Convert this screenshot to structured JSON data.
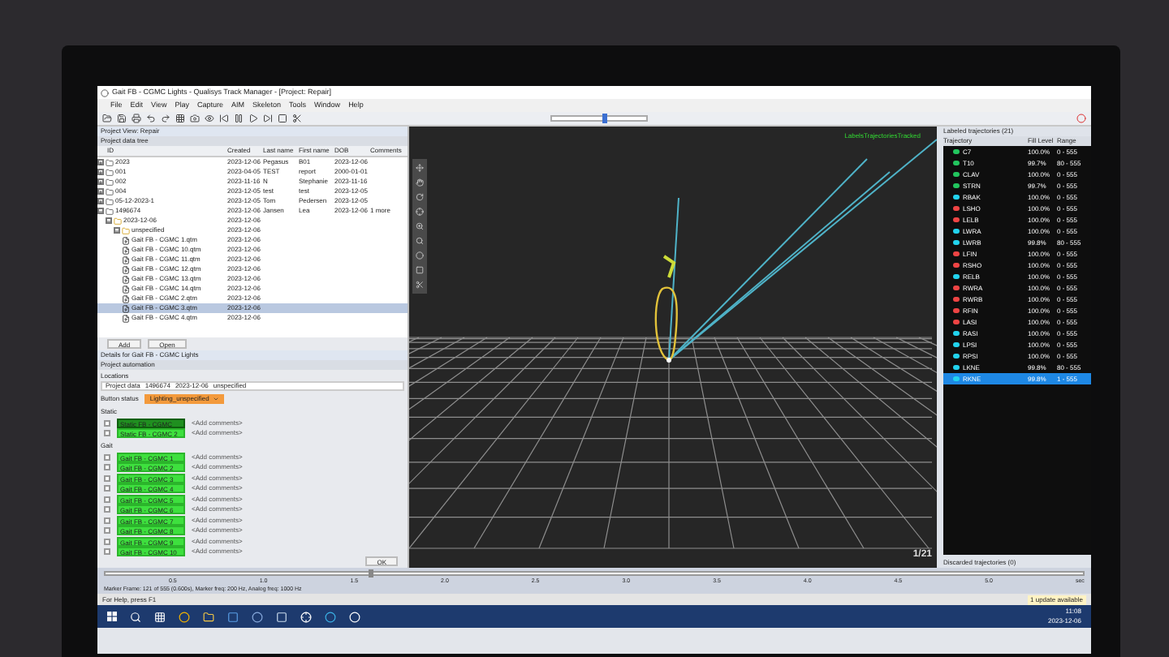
{
  "window": {
    "title": "Gait FB - CGMC Lights - Qualisys Track Manager - [Project: Repair]"
  },
  "speed_slider": {
    "level": 0.55
  },
  "menu": [
    "File",
    "Edit",
    "View",
    "Play",
    "Capture",
    "AIM",
    "Skeleton",
    "Tools",
    "Window",
    "Help"
  ],
  "project_view": {
    "title": "Project View: Repair",
    "tree_title": "Project data tree",
    "columns": [
      "ID",
      "Created",
      "Last name",
      "First name",
      "DOB",
      "Comments"
    ],
    "rows": [
      {
        "kind": "folder",
        "cells": [
          "2023",
          "2023-12-06",
          "Pegasus",
          "B01",
          "2023-12-06"
        ],
        "expanded": false,
        "selected": false
      },
      {
        "kind": "folder",
        "cells": [
          "001",
          "2023-04-05",
          "TEST",
          "report",
          "2000-01-01"
        ],
        "expanded": false,
        "selected": false
      },
      {
        "kind": "folder",
        "cells": [
          "002",
          "2023-11-16",
          "N",
          "Stephanie",
          "2023-11-16"
        ],
        "expanded": false,
        "selected": false
      },
      {
        "kind": "folder",
        "cells": [
          "004",
          "2023-12-05",
          "test",
          "test",
          "2023-12-05"
        ],
        "expanded": false,
        "selected": false
      },
      {
        "kind": "folder",
        "cells": [
          "05-12-2023-1",
          "2023-12-05",
          "Tom",
          "Pedersen",
          "2023-12-05"
        ],
        "expanded": false,
        "selected": false
      },
      {
        "kind": "folder",
        "cells": [
          "1496674",
          "2023-12-06",
          "Jansen",
          "Lea",
          "2023-12-06",
          "1 more"
        ],
        "expanded": true,
        "selected": false,
        "children": [
          {
            "kind": "folder",
            "cells": [
              "2023-12-06",
              "2023-12-06"
            ],
            "expanded": true,
            "selected": false,
            "children": [
              {
                "kind": "folder",
                "cells": [
                  "unspecified",
                  "2023-12-06"
                ],
                "expanded": true,
                "selected": false,
                "children": [
                  {
                    "kind": "file",
                    "cells": [
                      "Gait FB - CGMC 1.qtm",
                      "2023-12-06"
                    ],
                    "selected": false
                  },
                  {
                    "kind": "file",
                    "cells": [
                      "Gait FB - CGMC 10.qtm",
                      "2023-12-06"
                    ],
                    "selected": false
                  },
                  {
                    "kind": "file",
                    "cells": [
                      "Gait FB - CGMC 11.qtm",
                      "2023-12-06"
                    ],
                    "selected": false
                  },
                  {
                    "kind": "file",
                    "cells": [
                      "Gait FB - CGMC 12.qtm",
                      "2023-12-06"
                    ],
                    "selected": false
                  },
                  {
                    "kind": "file",
                    "cells": [
                      "Gait FB - CGMC 13.qtm",
                      "2023-12-06"
                    ],
                    "selected": false
                  },
                  {
                    "kind": "file",
                    "cells": [
                      "Gait FB - CGMC 14.qtm",
                      "2023-12-06"
                    ],
                    "selected": false
                  },
                  {
                    "kind": "file",
                    "cells": [
                      "Gait FB - CGMC 2.qtm",
                      "2023-12-06"
                    ],
                    "selected": false
                  },
                  {
                    "kind": "file",
                    "cells": [
                      "Gait FB - CGMC 3.qtm",
                      "2023-12-06"
                    ],
                    "selected": true
                  },
                  {
                    "kind": "file",
                    "cells": [
                      "Gait FB - CGMC 4.qtm",
                      "2023-12-06"
                    ],
                    "selected": false
                  }
                ]
              }
            ]
          }
        ]
      }
    ],
    "buttons": [
      "Add",
      "Open"
    ]
  },
  "details": {
    "title": "Details for Gait FB - CGMC Lights",
    "automation_title": "Project automation",
    "locations_label": "Locations",
    "path": [
      "Project data",
      "1496674",
      "2023-12-06",
      "unspecified"
    ],
    "status_label": "Button status",
    "status_value": "Lighting_unspecified",
    "groups": [
      {
        "label": "Static",
        "items": [
          {
            "name": "Static FB - CGMC",
            "selected": true,
            "checked": false,
            "comment": "<Add comments>"
          },
          {
            "name": "Static FB - CGMC 2",
            "selected": false,
            "checked": false,
            "comment": "<Add comments>"
          }
        ]
      },
      {
        "label": "Gait",
        "items": [
          {
            "name": "Gait FB - CGMC 1",
            "selected": false,
            "checked": false,
            "comment": "<Add comments>"
          },
          {
            "name": "Gait FB - CGMC 2",
            "selected": false,
            "checked": false,
            "comment": "<Add comments>"
          },
          {
            "name": "Gait FB - CGMC 3",
            "selected": false,
            "checked": false,
            "comment": "<Add comments>"
          },
          {
            "name": "Gait FB - CGMC 4",
            "selected": false,
            "checked": false,
            "comment": "<Add comments>"
          },
          {
            "name": "Gait FB - CGMC 5",
            "selected": false,
            "checked": false,
            "comment": "<Add comments>"
          },
          {
            "name": "Gait FB - CGMC 6",
            "selected": false,
            "checked": false,
            "comment": "<Add comments>"
          },
          {
            "name": "Gait FB - CGMC 7",
            "selected": false,
            "checked": false,
            "comment": "<Add comments>"
          },
          {
            "name": "Gait FB - CGMC 8",
            "selected": false,
            "checked": false,
            "comment": "<Add comments>"
          },
          {
            "name": "Gait FB - CGMC 9",
            "selected": false,
            "checked": false,
            "comment": "<Add comments>"
          },
          {
            "name": "Gait FB - CGMC 10",
            "selected": false,
            "checked": false,
            "comment": "<Add comments>"
          }
        ]
      }
    ],
    "ok_button": "OK"
  },
  "viewer": {
    "overlay_label": "LabelsTrajectoriesTracked",
    "frame": "1/21"
  },
  "trajectories": {
    "title": "Labeled trajectories (21)",
    "columns": [
      "Trajectory",
      "Fill Level",
      "Range"
    ],
    "rows": [
      {
        "name": "C7",
        "color": "#22c55e",
        "fill": "100.0%",
        "range": "0 - 555",
        "selected": false
      },
      {
        "name": "T10",
        "color": "#22c55e",
        "fill": "99.7%",
        "range": "80 - 555",
        "selected": false
      },
      {
        "name": "CLAV",
        "color": "#22c55e",
        "fill": "100.0%",
        "range": "0 - 555",
        "selected": false
      },
      {
        "name": "STRN",
        "color": "#22c55e",
        "fill": "99.7%",
        "range": "0 - 555",
        "selected": false
      },
      {
        "name": "RBAK",
        "color": "#22d3ee",
        "fill": "100.0%",
        "range": "0 - 555",
        "selected": false
      },
      {
        "name": "LSHO",
        "color": "#ef4444",
        "fill": "100.0%",
        "range": "0 - 555",
        "selected": false
      },
      {
        "name": "LELB",
        "color": "#ef4444",
        "fill": "100.0%",
        "range": "0 - 555",
        "selected": false
      },
      {
        "name": "LWRA",
        "color": "#22d3ee",
        "fill": "100.0%",
        "range": "0 - 555",
        "selected": false
      },
      {
        "name": "LWRB",
        "color": "#22d3ee",
        "fill": "99.8%",
        "range": "80 - 555",
        "selected": false
      },
      {
        "name": "LFIN",
        "color": "#ef4444",
        "fill": "100.0%",
        "range": "0 - 555",
        "selected": false
      },
      {
        "name": "RSHO",
        "color": "#ef4444",
        "fill": "100.0%",
        "range": "0 - 555",
        "selected": false
      },
      {
        "name": "RELB",
        "color": "#22d3ee",
        "fill": "100.0%",
        "range": "0 - 555",
        "selected": false
      },
      {
        "name": "RWRA",
        "color": "#ef4444",
        "fill": "100.0%",
        "range": "0 - 555",
        "selected": false
      },
      {
        "name": "RWRB",
        "color": "#ef4444",
        "fill": "100.0%",
        "range": "0 - 555",
        "selected": false
      },
      {
        "name": "RFIN",
        "color": "#ef4444",
        "fill": "100.0%",
        "range": "0 - 555",
        "selected": false
      },
      {
        "name": "LASI",
        "color": "#ef4444",
        "fill": "100.0%",
        "range": "0 - 555",
        "selected": false
      },
      {
        "name": "RASI",
        "color": "#22d3ee",
        "fill": "100.0%",
        "range": "0 - 555",
        "selected": false
      },
      {
        "name": "LPSI",
        "color": "#22d3ee",
        "fill": "100.0%",
        "range": "0 - 555",
        "selected": false
      },
      {
        "name": "RPSI",
        "color": "#22d3ee",
        "fill": "100.0%",
        "range": "0 - 555",
        "selected": false
      },
      {
        "name": "LKNE",
        "color": "#22d3ee",
        "fill": "99.8%",
        "range": "80 - 555",
        "selected": false
      },
      {
        "name": "RKNE",
        "color": "#22d3ee",
        "fill": "99.8%",
        "range": "1 - 555",
        "selected": true
      }
    ],
    "discarded_title": "Discarded trajectories (0)"
  },
  "timeline": {
    "level": 0.27,
    "ticks": [
      "0.5",
      "1.0",
      "1.5",
      "2.0",
      "2.5",
      "3.0",
      "3.5",
      "4.0",
      "4.5",
      "5.0",
      "sec"
    ],
    "status": "Marker Frame: 121 of 555 (0.600s), Marker freq: 200 Hz, Analog freq: 1000 Hz"
  },
  "status_bar": {
    "help": "For Help, press F1",
    "notice": "1 update available"
  },
  "taskbar": {
    "time": "11:08",
    "date": "2023-12-06"
  }
}
